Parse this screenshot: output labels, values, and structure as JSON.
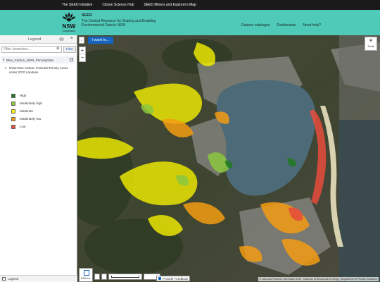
{
  "topbar": {
    "links": [
      "The SEED Initiative",
      "Citizen Science Hub",
      "SEED Miners and Explorer's Map"
    ]
  },
  "header": {
    "logo_text": "NSW",
    "logo_subtext": "GOVERNMENT",
    "title": "SEED",
    "tagline": "The Central Resource for Sharing and Enabling Environmental Data in NSW",
    "nav": [
      "Dataset catalogue",
      "Dashboards",
      "Need help?"
    ],
    "bg_color": "#4fc9b8"
  },
  "panel": {
    "legend_title": "Legend",
    "filter_placeholder": "Filter (searches...",
    "filter_clear_icon": "close-circle-icon",
    "filter_button": "Filter",
    "layer_group": "Blue_Carbon_NSW_PrimaryData",
    "layer_name": "NSW Blue Carbon Potential Priority Areas under 2070 Landuse",
    "legend": [
      {
        "label": "High",
        "color": "#1e7a1e"
      },
      {
        "label": "Moderately high",
        "color": "#8cc63f"
      },
      {
        "label": "Moderate",
        "color": "#f4f000"
      },
      {
        "label": "Moderately low",
        "color": "#f39c12"
      },
      {
        "label": "Low",
        "color": "#e74c3c"
      }
    ],
    "footer_label": "Legend"
  },
  "map": {
    "i_want_to": "I want to...",
    "zoom_in": "+",
    "zoom_out": "−",
    "tools_label": "Tools",
    "basemap_label": "NSW Im...",
    "feedback_label": "Provide Feedback",
    "attribution": "© Land and Property Information 2015 · Discover at Resources & Energy | Department of Primary Industries"
  }
}
